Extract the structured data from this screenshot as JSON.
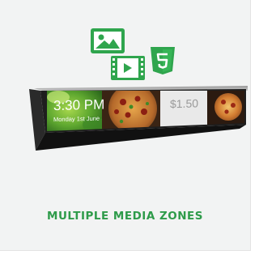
{
  "theme": {
    "background": "#f2f3f3",
    "accent_green": "#2e9b4a",
    "icon_green": "#2fa54d",
    "bezel": "#1e1e1e",
    "display_panel": "#222222"
  },
  "icons": {
    "image": "image-icon",
    "video": "video-icon",
    "html5": "html5-icon"
  },
  "display": {
    "clock": {
      "time": "3:30 PM",
      "date": "Monday 1st June"
    },
    "price": "$1.50"
  },
  "caption": "MULTIPLE MEDIA ZONES"
}
